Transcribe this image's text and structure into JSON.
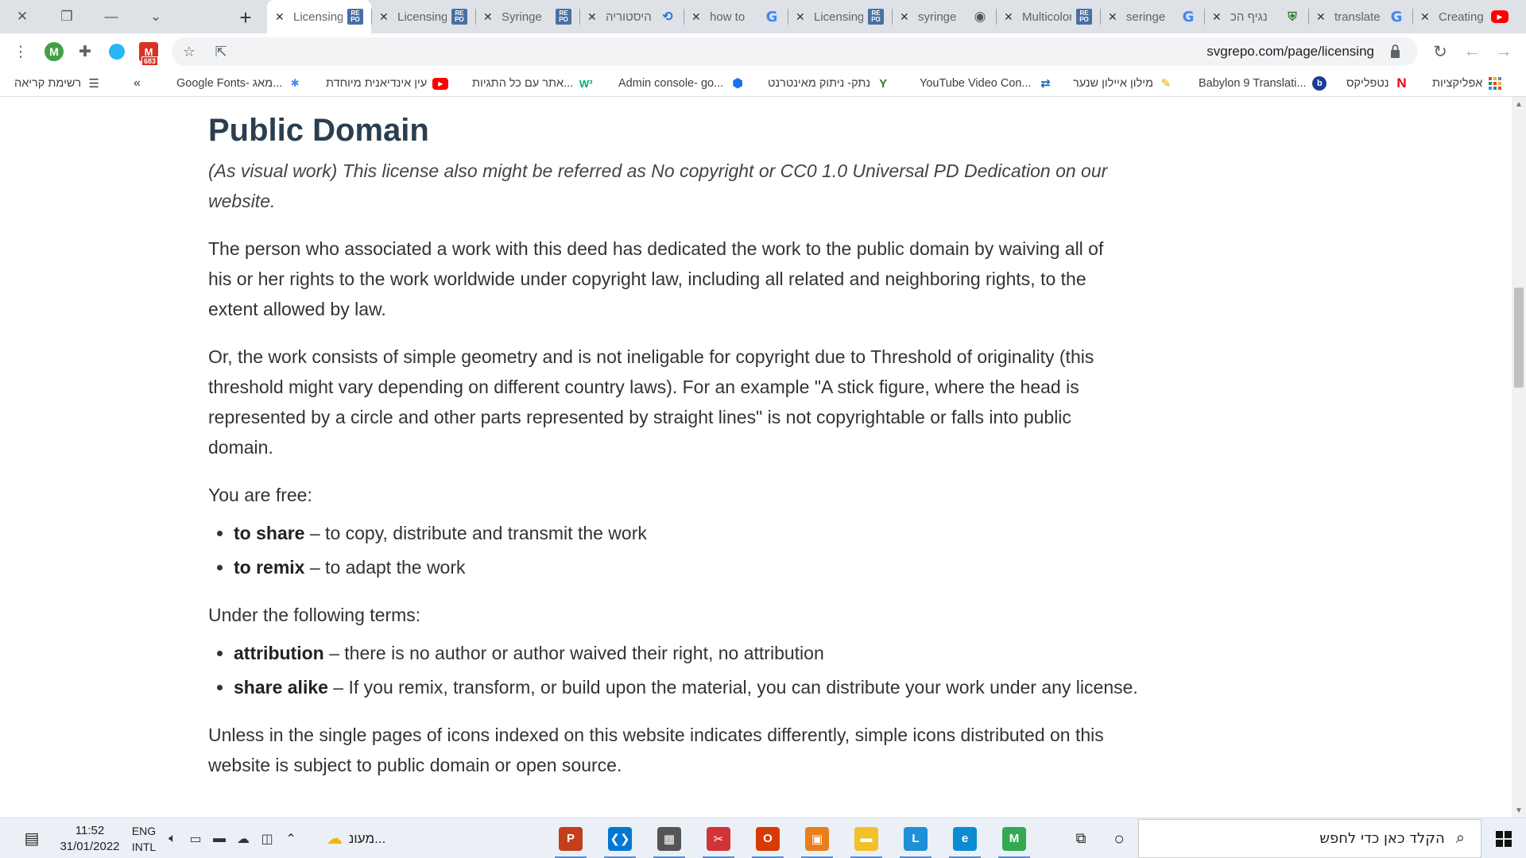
{
  "window": {
    "controls": [
      "close-icon",
      "restore-icon",
      "minimize-icon",
      "tab-search-icon"
    ]
  },
  "tabs": [
    {
      "title": "Licensing",
      "favicon": "svgrepo-icon",
      "active": true
    },
    {
      "title": "Licensing",
      "favicon": "svgrepo-icon"
    },
    {
      "title": "Syringe",
      "favicon": "svgrepo-icon"
    },
    {
      "title": "היסטוריה",
      "favicon": "history-icon"
    },
    {
      "title": "how to",
      "favicon": "google-icon"
    },
    {
      "title": "Licensing",
      "favicon": "svgrepo-icon"
    },
    {
      "title": "syringe",
      "favicon": "globe-icon"
    },
    {
      "title": "Multicolor",
      "favicon": "svgrepo-icon"
    },
    {
      "title": "seringe",
      "favicon": "google-icon"
    },
    {
      "title": "נגיף הכ",
      "favicon": "shield-icon"
    },
    {
      "title": "translate",
      "favicon": "google-icon"
    },
    {
      "title": "Creating",
      "favicon": "youtube-icon"
    }
  ],
  "toolbar": {
    "avatar_letter": "M",
    "gmail_badge": "683",
    "url": "svgrepo.com/page/licensing"
  },
  "bookmarks": {
    "reading_list": "רשימת קריאה",
    "more": "«",
    "items": [
      {
        "label": "Google Fonts- מאג...",
        "icon": "google-fonts-icon"
      },
      {
        "label": "עין אינדיאנית מיוחדת",
        "icon": "youtube-icon"
      },
      {
        "label": "אתר עם כל התגיות...",
        "icon": "w3-icon"
      },
      {
        "label": "Admin console- go...",
        "icon": "admin-icon"
      },
      {
        "label": "נתק- ניתוק מאינטרנט",
        "icon": "netek-icon"
      },
      {
        "label": "YouTube Video Con...",
        "icon": "converter-icon"
      },
      {
        "label": "מילון איילון שנער",
        "icon": "quill-icon"
      },
      {
        "label": "Babylon 9 Translati...",
        "icon": "babylon-icon"
      },
      {
        "label": "נטפליקס",
        "icon": "netflix-icon"
      },
      {
        "label": "אפליקציות",
        "icon": "apps-icon"
      }
    ]
  },
  "page": {
    "heading": "Public Domain",
    "lead": "(As visual work) This license also might be referred as No copyright or CC0 1.0 Universal PD Dedication on our website.",
    "p1": "The person who associated a work with this deed has dedicated the work to the public domain by waiving all of his or her rights to the work worldwide under copyright law, including all related and neighboring rights, to the extent allowed by law.",
    "p2": "Or, the work consists of simple geometry and is not ineligable for copyright due to Threshold of originality (this threshold might vary depending on different country laws). For an example \"A stick figure, where the head is represented by a circle and other parts represented by straight lines\" is not copyrightable or falls into public domain.",
    "free_intro": "You are free:",
    "free": [
      {
        "term": "to share",
        "desc": " – to copy, distribute and transmit the work"
      },
      {
        "term": "to remix",
        "desc": " – to adapt the work"
      }
    ],
    "terms_intro": "Under the following terms:",
    "terms": [
      {
        "term": "attribution",
        "desc": " – there is no author or author waived their right, no attribution"
      },
      {
        "term": "share alike",
        "desc": " – If you remix, transform, or build upon the material, you can distribute your work under any license."
      }
    ],
    "p3": "Unless in the single pages of icons indexed on this website indicates differently, simple icons distributed on this website is subject to public domain or open source."
  },
  "taskbar": {
    "time": "11:52",
    "date": "31/01/2022",
    "lang_top": "ENG",
    "lang_bottom": "INTL",
    "weather": "מעונ...",
    "search_placeholder": "הקלד כאן כדי לחפש",
    "apps": [
      {
        "name": "powerpoint",
        "glyph": "P",
        "color": "#c43e1c"
      },
      {
        "name": "vscode",
        "glyph": "❮❯",
        "color": "#0078d4"
      },
      {
        "name": "calculator",
        "glyph": "▦",
        "color": "#555"
      },
      {
        "name": "snipping-tool",
        "glyph": "✂",
        "color": "#d13438"
      },
      {
        "name": "office",
        "glyph": "O",
        "color": "#d83b01"
      },
      {
        "name": "tool",
        "glyph": "▣",
        "color": "#e87f1c"
      },
      {
        "name": "file-explorer",
        "glyph": "▬",
        "color": "#f2c029"
      },
      {
        "name": "lingo",
        "glyph": "L",
        "color": "#1f8fd6"
      },
      {
        "name": "edge",
        "glyph": "e",
        "color": "#0c8bd1"
      },
      {
        "name": "chrome",
        "glyph": "M",
        "color": "#34a853"
      }
    ]
  },
  "colors": {
    "heading": "#2b3e4f",
    "body_text": "#333333",
    "tabstrip": "#dee1e6",
    "taskbar": "#eaf0f6"
  }
}
